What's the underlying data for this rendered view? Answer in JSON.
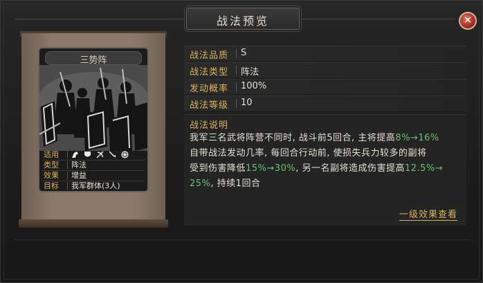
{
  "window": {
    "title": "战法预览",
    "close_label": "✕"
  },
  "card": {
    "name": "三势阵",
    "rows": [
      {
        "label": "适用",
        "value": ""
      },
      {
        "label": "类型",
        "value": "阵法"
      },
      {
        "label": "效果",
        "value": "增益"
      },
      {
        "label": "目标",
        "value": "我军群体(3人)"
      }
    ],
    "unit_icons": [
      "cavalry-icon",
      "shield-icon",
      "archer-icon",
      "spear-icon",
      "siege-icon"
    ]
  },
  "attributes": [
    {
      "label": "战法品质",
      "value": "S"
    },
    {
      "label": "战法类型",
      "value": "阵法"
    },
    {
      "label": "发动概率",
      "value": "100%"
    },
    {
      "label": "战法等级",
      "value": "10"
    }
  ],
  "description": {
    "title": "战法说明",
    "l1_a": "我军三名武将阵营不同时, 战斗前5回合, 主将提高",
    "l1_b": "8%→16%",
    "l2": "自带战法发动几率, 每回合行动前, 使损失兵力较多的副将",
    "l3_a": "受到伤害降低",
    "l3_b": "15%→30%",
    "l3_c": ", 另一名副将造成伤害提高",
    "l3_d": "12.5%→",
    "l4_a": "25%",
    "l4_b": ", 持续1回合"
  },
  "more_effects_label": "一级效果查看",
  "colors": {
    "gold": "#d9b45a",
    "green": "#6bbf74",
    "close_red": "#9b2418"
  }
}
